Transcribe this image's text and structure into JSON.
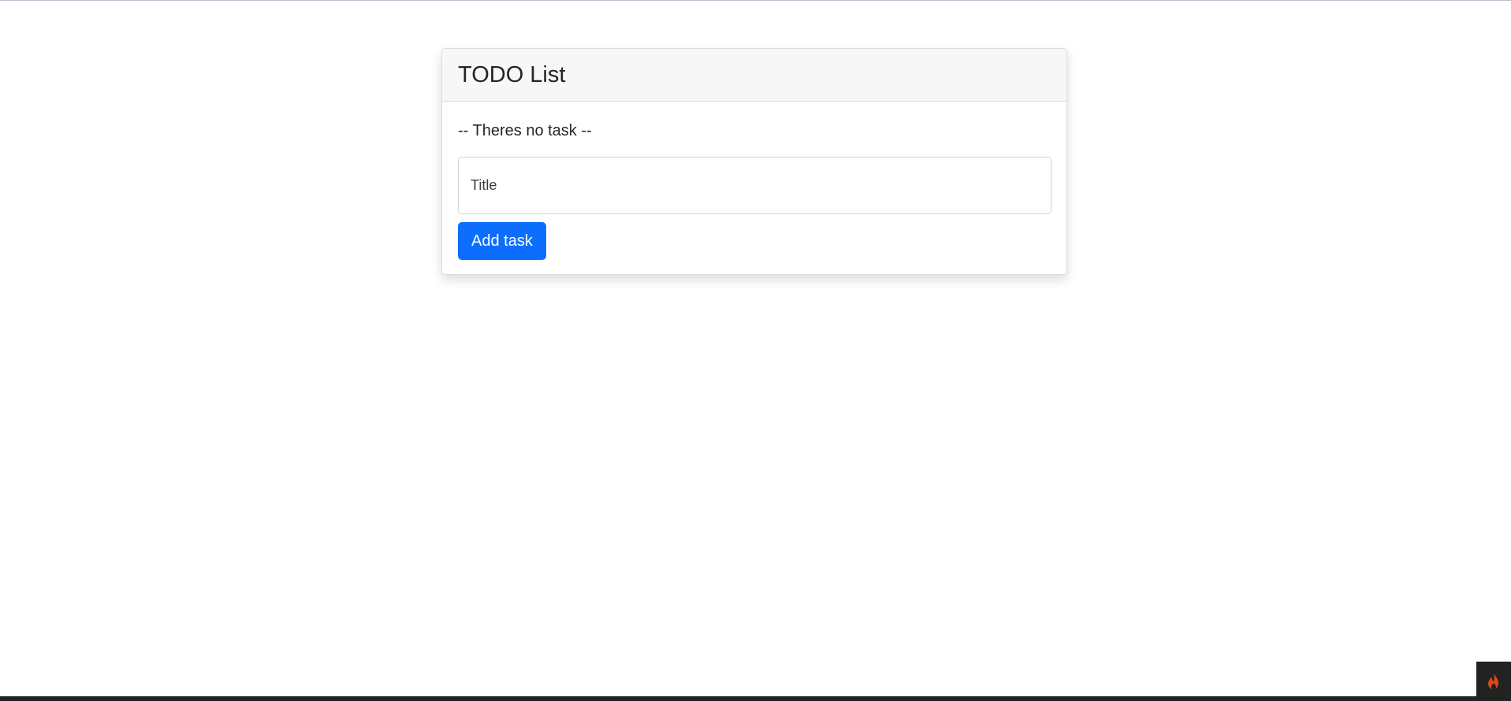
{
  "todo": {
    "title": "TODO List",
    "empty_message": "-- Theres no task --",
    "title_input": {
      "placeholder": "Title",
      "value": ""
    },
    "add_button_label": "Add task"
  },
  "debug_toolbar": {
    "icon": "flame-icon",
    "icon_color": "#dd4814",
    "background": "#222222"
  },
  "colors": {
    "primary": "#0d6efd",
    "header_bg": "#f7f7f7"
  }
}
